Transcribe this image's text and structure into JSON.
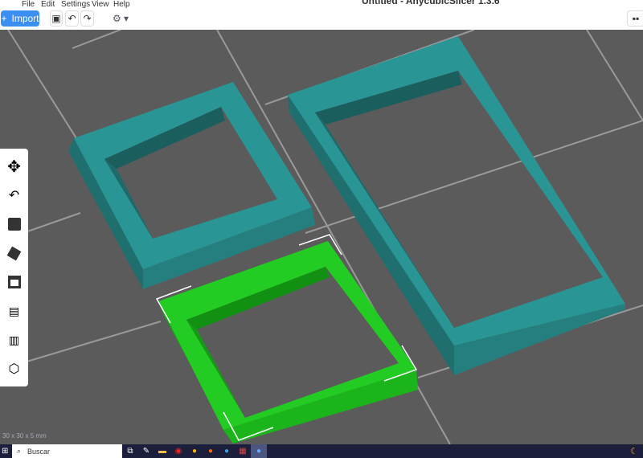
{
  "menu": [
    "File",
    "Edit",
    "Settings",
    "View",
    "Help"
  ],
  "window_title": "Untitled - AnycubicSlicer 1.3.6",
  "toolbar": {
    "import_label": "Import",
    "import_icon": "plus-icon",
    "save_icon": "save-icon",
    "undo_icon": "undo-icon",
    "redo_icon": "redo-icon",
    "view_icon": "gear-icon",
    "layout_icon": "grid-icon"
  },
  "left_tools": [
    "move",
    "rotate",
    "scale",
    "lay-on-face",
    "cut",
    "support",
    "seam",
    "assembly"
  ],
  "status": {
    "dimensions": "30 x 30 x 5 mm"
  },
  "taskbar": {
    "search_placeholder": "Buscar"
  },
  "colors": {
    "accent": "#3b8ff0",
    "object": "#2a8c8c",
    "selected": "#1fc01f",
    "bed": "#5b5b5b"
  }
}
